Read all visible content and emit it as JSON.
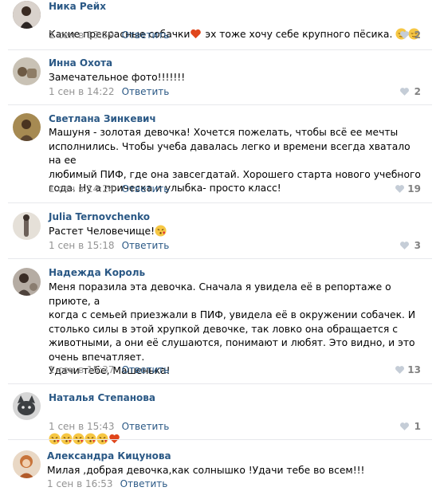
{
  "comments": [
    {
      "name": "Ника Рейх",
      "text": "Какие прекрасные собачки",
      "text2": " эх тоже хочу себе крупного пёсика. ",
      "date": "1 сен в 13:59",
      "reply": "Ответить",
      "likes": "2",
      "avatar_color": "#7a6a60"
    },
    {
      "name": "Инна Охота",
      "text": "Замечательное фото!!!!!!!",
      "date": "1 сен в 14:22",
      "reply": "Ответить",
      "likes": "2",
      "avatar_color": "#9a8a70"
    },
    {
      "name": "Светлана Зинкевич",
      "text": "Машуня - золотая девочка! Хочется пожелать, чтобы всё ее мечты\nисполнились. Чтобы учеба давалась легко и времени всегда хватало на ее\nлюбимый ПИФ, где она завсегдатай. Хорошего старта нового учебного\nгода. Ну а прическа и улыбка- просто класс!",
      "date": "1 сен в 14:24",
      "reply": "Ответить",
      "likes": "19",
      "avatar_color": "#8d6a3a"
    },
    {
      "name": "Julia Ternovchenko",
      "text": "Растет Человечище!",
      "date": "1 сен в 15:18",
      "reply": "Ответить",
      "likes": "3",
      "avatar_color": "#b5a89a"
    },
    {
      "name": "Надежда Король",
      "text": "Меня поразила эта девочка. Сначала я увидела её в репортаже о приюте, а\nкогда с семьей приезжали в ПИФ, увидела её в окружении собачек. И\nстолько силы в этой хрупкой девочке, так ловко она обращается с\nживотными, а они её слушаются, понимают и любят. Это видно, и это\nочень впечатляет.\nУдачи тебе, Машенька!",
      "date": "1 сен в 15:37",
      "reply": "Ответить",
      "likes": "13",
      "avatar_color": "#6b5e55"
    },
    {
      "name": "Наталья Степанова",
      "text": "",
      "date": "1 сен в 15:43",
      "reply": "Ответить",
      "likes": "1",
      "avatar_color": "#5f6468"
    },
    {
      "name": "Александра Кицунова",
      "text": "Милая ,добрая девочка,как солнышко !Удачи тебе во всем!!!",
      "date": "1 сен в 16:53",
      "reply": "Ответить",
      "likes": "",
      "avatar_color": "#c8743a"
    }
  ],
  "colors": {
    "link": "#2a5885",
    "meta": "#939393",
    "heart": "#c5cdd7",
    "divider": "#e7e8ec"
  },
  "icons": {
    "like": "heart-icon",
    "kiss": "kiss-emoji",
    "relieved": "relieved-emoji",
    "heart_emoji": "heart-emoji"
  }
}
